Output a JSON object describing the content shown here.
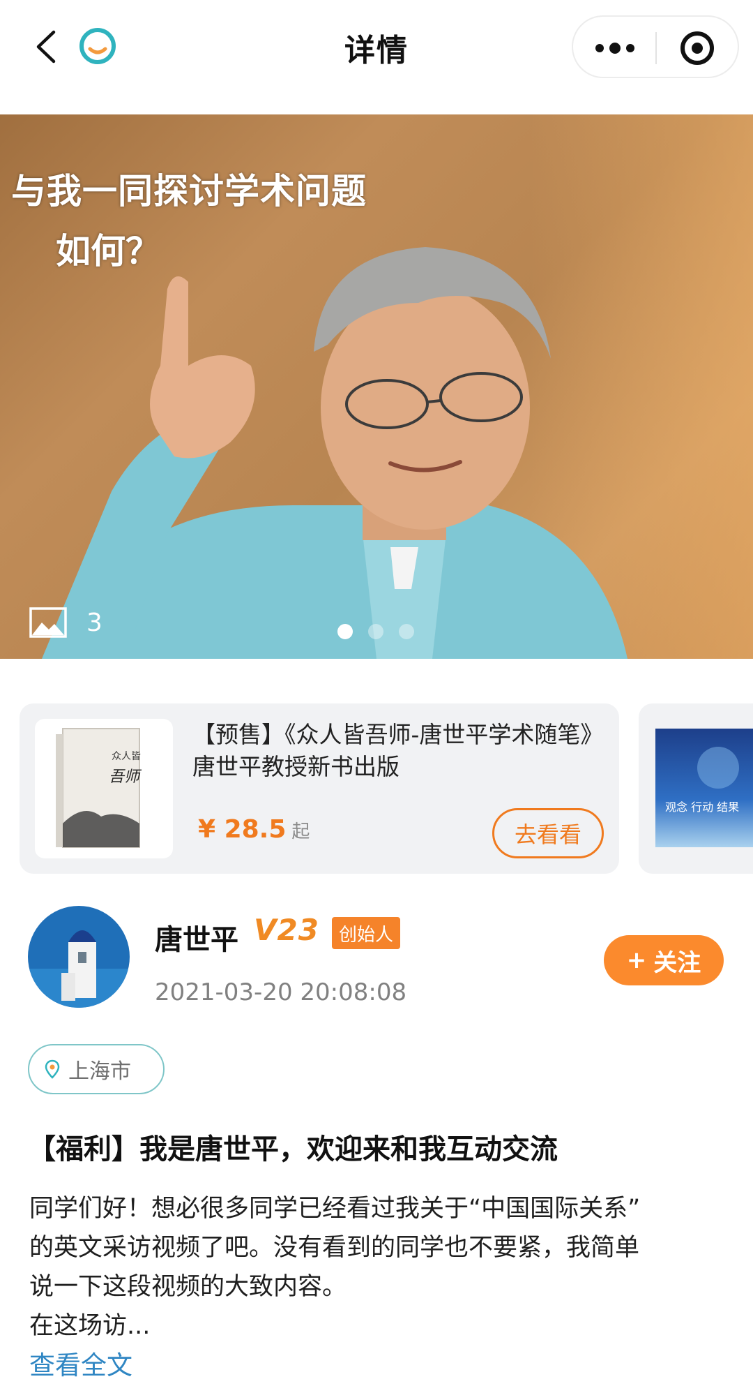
{
  "navbar": {
    "title": "详情"
  },
  "hero": {
    "caption_line1": "与我一同探讨学术问题",
    "caption_line2": "如何？",
    "image_count": "3",
    "slides_total": 3,
    "active_slide": 1
  },
  "products": [
    {
      "title": "【预售】《众人皆吾师-唐世平学术随笔》唐世平教授新书出版",
      "price": "¥ 28.5",
      "price_suffix": "起",
      "button": "去看看",
      "cover_text_top": "众人皆",
      "cover_text_main": "吾师"
    },
    {
      "cover_text": "观念 行动 结果"
    }
  ],
  "author": {
    "name": "唐世平",
    "level": "V23",
    "badge": "创始人",
    "time": "2021-03-20 20:08:08",
    "follow_label": "关注",
    "follow_icon": "+"
  },
  "location": {
    "label": "上海市"
  },
  "post": {
    "title": "【福利】我是唐世平，欢迎来和我互动交流",
    "body_line1": "同学们好！想必很多同学已经看过我关于“中国国际关系”",
    "body_line2": "的英文采访视频了吧。没有看到的同学也不要紧，我简单",
    "body_line3": "说一下这段视频的大致内容。",
    "body_line4": "在这场访...",
    "read_more": "查看全文"
  },
  "colors": {
    "accent_orange": "#f07a1e",
    "follow_orange": "#fb8a2d",
    "link_blue": "#2f86c3",
    "location_border": "#7fc6c8"
  }
}
